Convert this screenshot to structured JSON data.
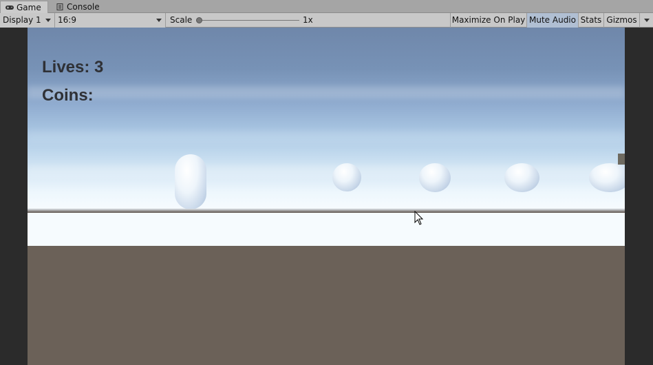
{
  "tabs": [
    {
      "label": "Game",
      "icon": "gamepad-icon",
      "active": true
    },
    {
      "label": "Console",
      "icon": "console-icon",
      "active": false
    }
  ],
  "toolbar": {
    "display": "Display 1",
    "aspect": "16:9",
    "scale_label": "Scale",
    "scale_value": "1x",
    "maximize_on_play": "Maximize On Play",
    "mute_audio": "Mute Audio",
    "mute_audio_active": true,
    "stats": "Stats",
    "gizmos": "Gizmos"
  },
  "game": {
    "lives": "Lives: 3",
    "coins": "Coins:"
  },
  "colors": {
    "hud_text": "#2f3136",
    "toolbar_bg": "#c8c8c8",
    "toggle_on": "#b0bfd3",
    "ground": "#6b6158",
    "floor": "#f6fbfe"
  }
}
